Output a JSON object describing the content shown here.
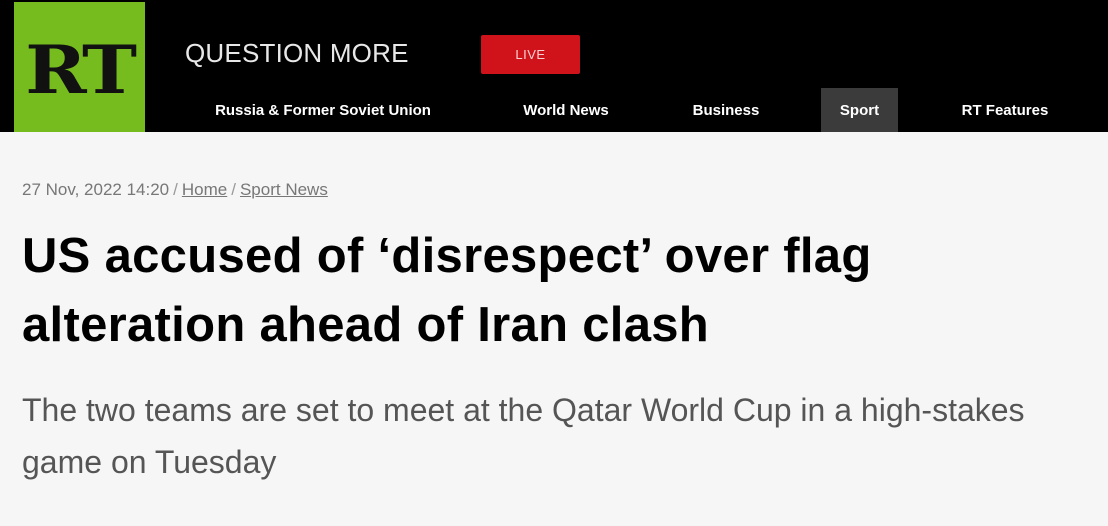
{
  "header": {
    "logo_text": "RT",
    "tagline": "QUESTION MORE",
    "live_label": "LIVE",
    "colors": {
      "logo_bg": "#77bc1f",
      "live_bg": "#d0121a",
      "bar_bg": "#000000",
      "active_nav_bg": "#3b3b3b"
    }
  },
  "nav": {
    "items": [
      {
        "label": "Russia & Former Soviet Union",
        "active": false
      },
      {
        "label": "World News",
        "active": false
      },
      {
        "label": "Business",
        "active": false
      },
      {
        "label": "Sport",
        "active": true
      },
      {
        "label": "RT Features",
        "active": false
      }
    ]
  },
  "article": {
    "date": "27 Nov, 2022 14:20",
    "breadcrumbs": [
      "Home",
      "Sport News"
    ],
    "headline": "US accused of ‘disrespect’ over flag alteration ahead of Iran clash",
    "summary": "The two teams are set to meet at the Qatar World Cup in a high-stakes game on Tuesday"
  }
}
